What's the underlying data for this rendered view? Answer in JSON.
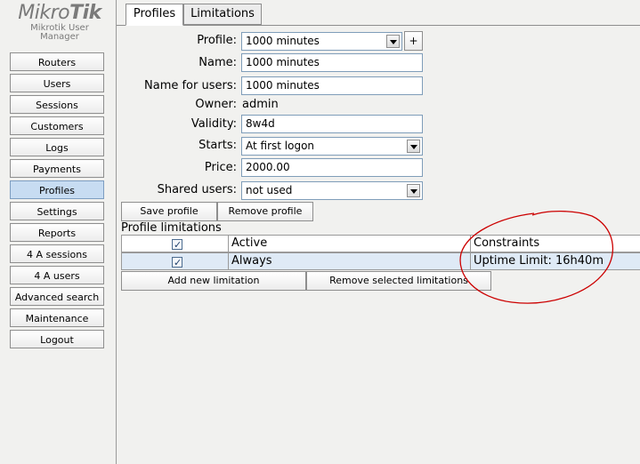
{
  "logo": {
    "brand_light": "Mikro",
    "brand_bold": "Tik",
    "subtitle": "Mikrotik User Manager"
  },
  "sidebar": {
    "items": [
      {
        "label": "Routers"
      },
      {
        "label": "Users"
      },
      {
        "label": "Sessions"
      },
      {
        "label": "Customers"
      },
      {
        "label": "Logs"
      },
      {
        "label": "Payments"
      },
      {
        "label": "Profiles",
        "active": true
      },
      {
        "label": "Settings"
      },
      {
        "label": "Reports"
      },
      {
        "label": "4 A sessions"
      },
      {
        "label": "4 A users"
      },
      {
        "label": "Advanced search"
      },
      {
        "label": "Maintenance"
      },
      {
        "label": "Logout"
      }
    ]
  },
  "tabs": [
    {
      "label": "Profiles",
      "active": true
    },
    {
      "label": "Limitations"
    }
  ],
  "form": {
    "profile_label": "Profile:",
    "profile_value": "1000 minutes",
    "add_button": "+",
    "name_label": "Name:",
    "name_value": "1000 minutes",
    "name_for_users_label": "Name for users:",
    "name_for_users_value": "1000 minutes",
    "owner_label": "Owner:",
    "owner_value": "admin",
    "validity_label": "Validity:",
    "validity_value": "8w4d",
    "starts_label": "Starts:",
    "starts_value": "At first logon",
    "price_label": "Price:",
    "price_value": "2000.00",
    "shared_users_label": "Shared users:",
    "shared_users_value": "not used",
    "save_button": "Save profile",
    "remove_button": "Remove profile"
  },
  "limitations": {
    "title": "Profile limitations",
    "header": {
      "checked": true,
      "name": "Active",
      "constraints": "Constraints"
    },
    "rows": [
      {
        "checked": true,
        "name": "Always",
        "constraints": "Uptime Limit: 16h40m"
      }
    ],
    "add_button": "Add new limitation",
    "remove_button": "Remove selected limitations"
  },
  "colors": {
    "selected_row": "#dfeaf6",
    "annotation": "#cc0000",
    "active_nav": "#c7dcf2"
  }
}
